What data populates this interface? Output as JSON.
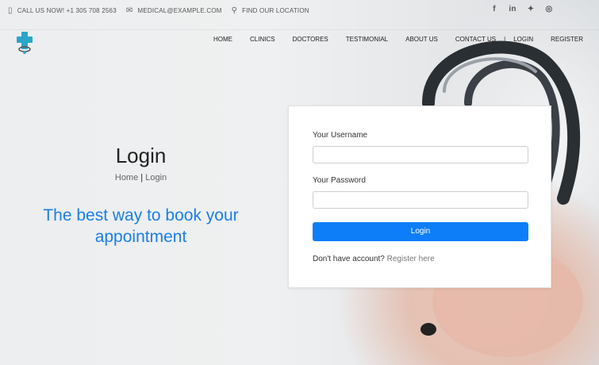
{
  "topbar": {
    "phone": "CALL US NOW! +1 305 708 2563",
    "email": "MEDICAL@EXAMPLE.COM",
    "location": "FIND OUR LOCATION",
    "social": [
      "f",
      "in",
      "t",
      "ig"
    ]
  },
  "nav": {
    "items": [
      "HOME",
      "CLINICS",
      "DOCTORES",
      "TESTIMONIAL",
      "ABOUT US",
      "CONTACT US",
      "LOGIN",
      "REGISTER"
    ],
    "separator": "|"
  },
  "hero": {
    "title": "Login",
    "breadcrumb_home": "Home",
    "breadcrumb_sep": " | ",
    "breadcrumb_current": "Login",
    "tagline": "The best way to book your appointment"
  },
  "form": {
    "username_label": "Your Username",
    "username_value": "",
    "password_label": "Your Password",
    "password_value": "",
    "submit_label": "Login",
    "no_account_text": "Don't have account?",
    "register_link": "Register here"
  },
  "colors": {
    "accent": "#0d7ef8",
    "tagline": "#1a7ee6"
  }
}
